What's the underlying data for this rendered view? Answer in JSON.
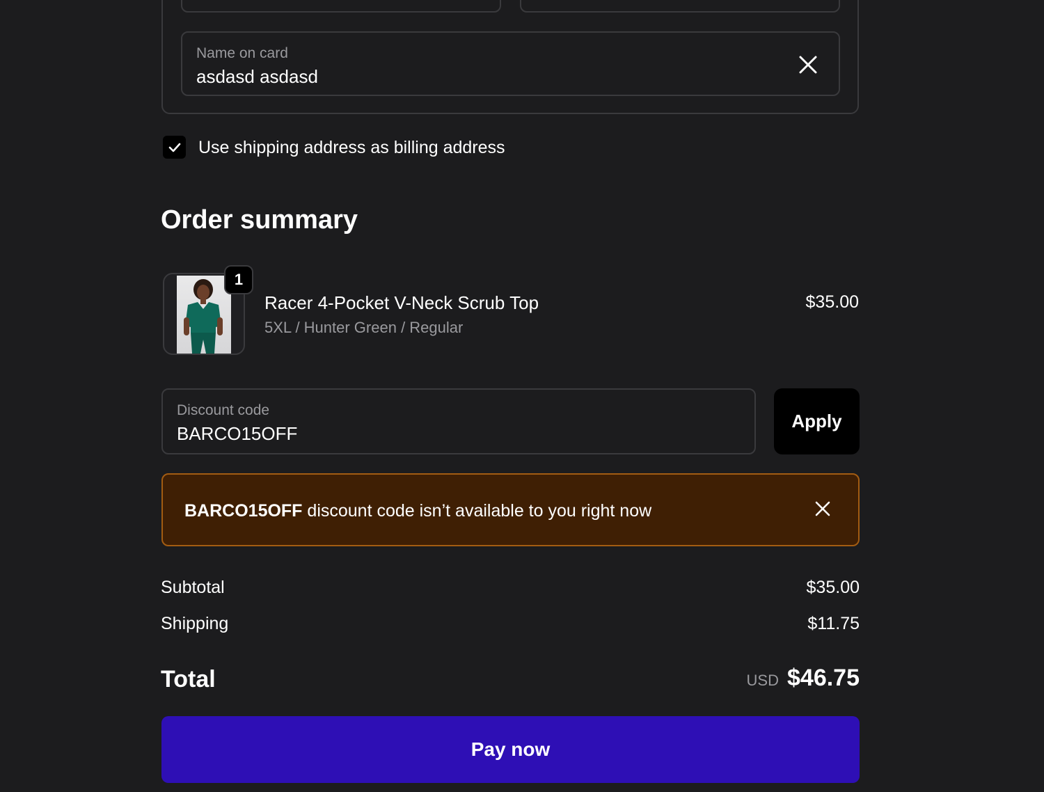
{
  "payment": {
    "name_label": "Name on card",
    "name_value": "asdasd asdasd",
    "billing_checkbox_checked": true,
    "billing_checkbox_label": "Use shipping address as billing address"
  },
  "order_summary": {
    "title": "Order summary",
    "items": [
      {
        "quantity": "1",
        "name": "Racer 4-Pocket V-Neck Scrub Top",
        "variant": "5XL / Hunter Green / Regular",
        "price": "$35.00"
      }
    ]
  },
  "discount": {
    "label": "Discount code",
    "value": "BARCO15OFF",
    "apply_label": "Apply",
    "error_code": "BARCO15OFF",
    "error_message": " discount code isn’t available to you right now"
  },
  "totals": {
    "subtotal_label": "Subtotal",
    "subtotal_value": "$35.00",
    "shipping_label": "Shipping",
    "shipping_value": "$11.75",
    "total_label": "Total",
    "currency": "USD",
    "total_value": "$46.75"
  },
  "pay_button_label": "Pay now",
  "colors": {
    "background": "#1c1c1e",
    "accent": "#2e0fb5",
    "warning_bg": "#3f1f04",
    "warning_border": "#a35c12"
  }
}
